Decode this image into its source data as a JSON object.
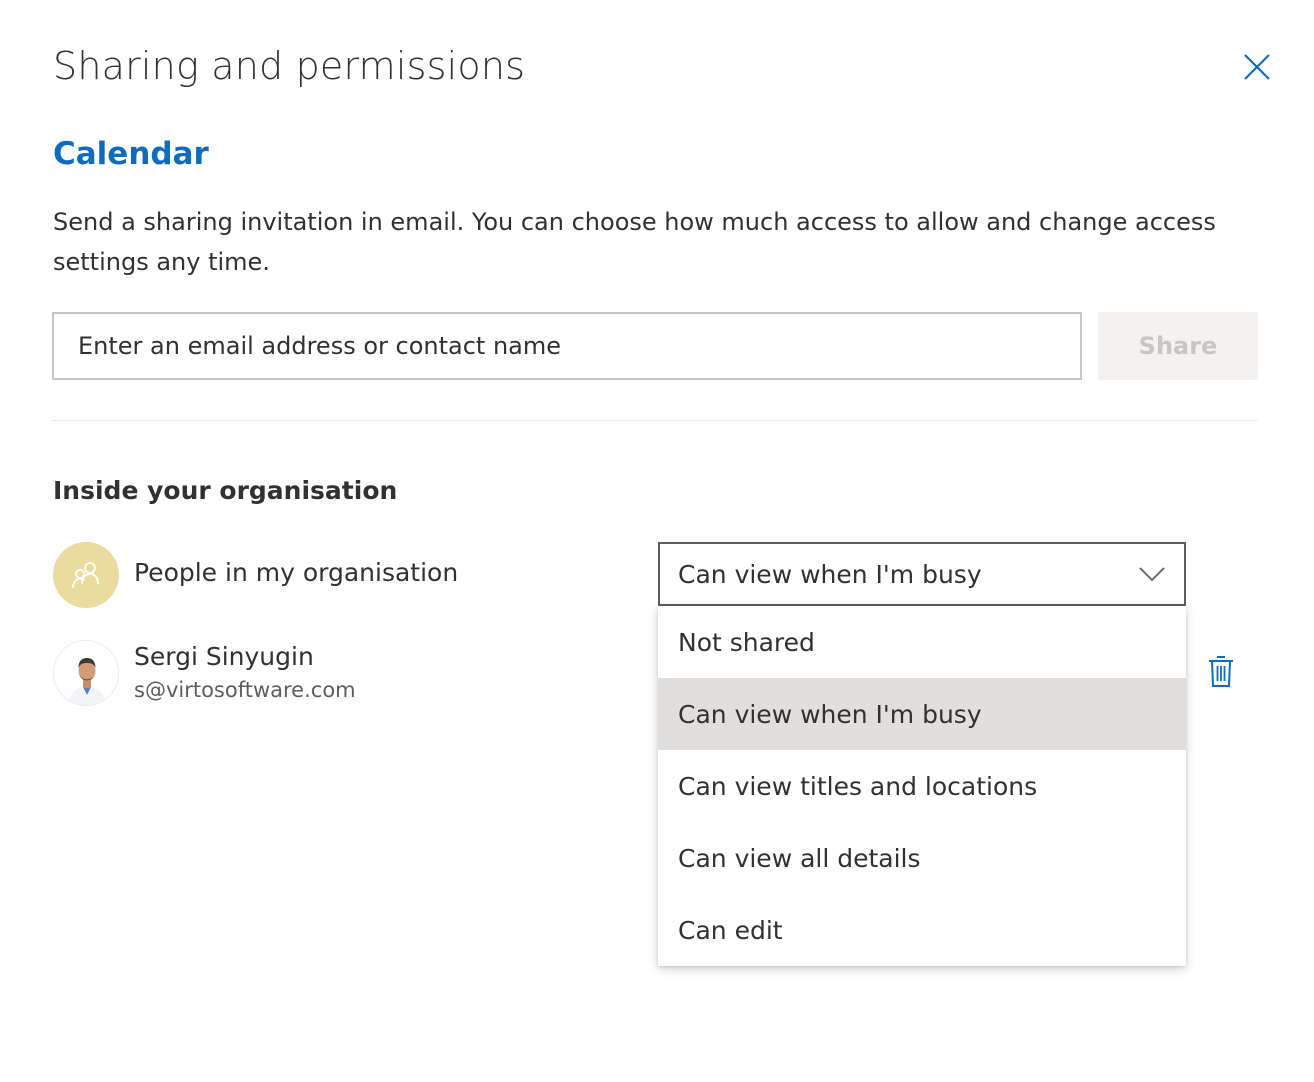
{
  "dialog": {
    "title": "Sharing and permissions"
  },
  "calendar": {
    "title": "Calendar",
    "description": "Send a sharing invitation in email. You can choose how much access to allow and change access settings any time."
  },
  "invite": {
    "placeholder": "Enter an email address or contact name",
    "share_label": "Share"
  },
  "inside_org": {
    "heading": "Inside your organisation",
    "org_row": {
      "label": "People in my organisation",
      "permission": "Can view when I'm busy"
    },
    "users": [
      {
        "name": "Sergi Sinyugin",
        "email": "s@virtosoftware.com"
      }
    ]
  },
  "permission_options": [
    "Not shared",
    "Can view when I'm busy",
    "Can view titles and locations",
    "Can view all details",
    "Can edit"
  ],
  "selected_option_index": 1,
  "colors": {
    "accent": "#0f6cbd",
    "org_avatar_bg": "#eadb9e",
    "selected_bg": "#e1dfdd",
    "disabled_button_bg": "#f3f2f1",
    "disabled_button_text": "#c8c6c4"
  },
  "icons": {
    "close": "close-icon",
    "people": "people-icon",
    "chevron": "chevron-down-icon",
    "delete": "trash-icon"
  }
}
